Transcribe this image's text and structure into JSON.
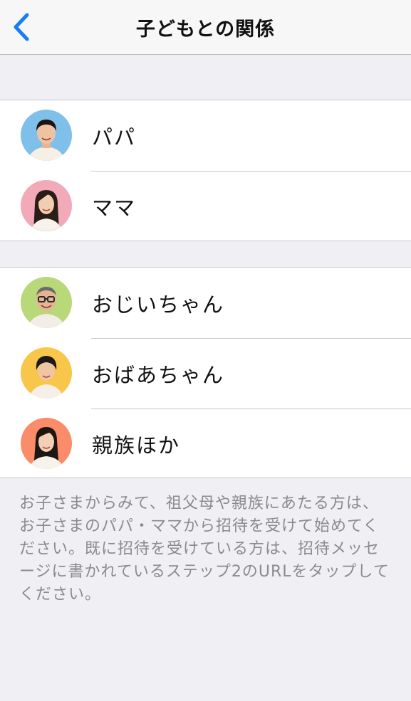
{
  "navbar": {
    "title": "子どもとの関係",
    "back_icon": "chevron-left-icon",
    "accent_color": "#1a7cf5"
  },
  "parents": [
    {
      "label": "パパ",
      "avatar_color": "#7ec0ea"
    },
    {
      "label": "ママ",
      "avatar_color": "#f2a9b8"
    }
  ],
  "relatives": [
    {
      "label": "おじいちゃん",
      "avatar_color": "#b8d87a"
    },
    {
      "label": "おばあちゃん",
      "avatar_color": "#f8c64a"
    },
    {
      "label": "親族ほか",
      "avatar_color": "#fb8c6a"
    }
  ],
  "footer": {
    "note": "お子さまからみて、祖父母や親族にあたる方は、お子さまのパパ・ママから招待を受けて始めてください。既に招待を受けている方は、招待メッセージに書かれているステップ2のURLをタップしてください。"
  }
}
